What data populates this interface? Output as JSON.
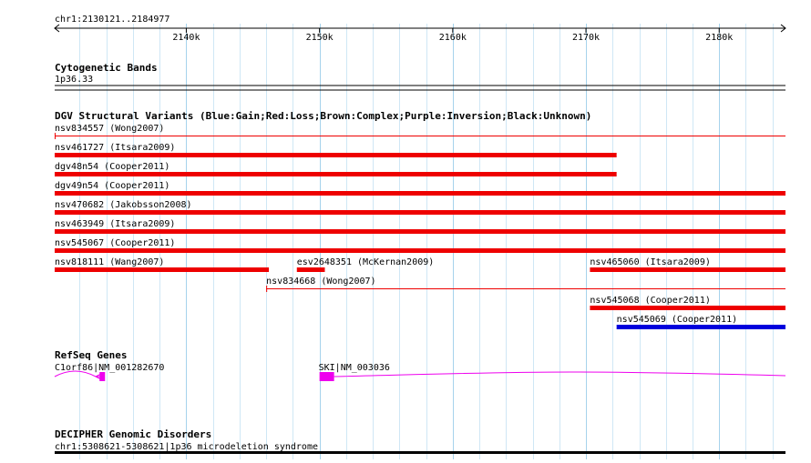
{
  "ruler": {
    "coordinates": "chr1:2130121..2184977",
    "ticks": [
      "2140k",
      "2150k",
      "2160k",
      "2170k",
      "2180k"
    ]
  },
  "tracks": {
    "cytobands": {
      "title": "Cytogenetic Bands",
      "band": "1p36.33"
    },
    "dgv": {
      "title": "DGV Structural Variants (Blue:Gain;Red:Loss;Brown:Complex;Purple:Inversion;Black:Unknown)",
      "colors": {
        "loss": "#ee0000",
        "gain": "#0000dd"
      },
      "variants": [
        {
          "label": "nsv834557 (Wong2007)",
          "start": 2130121,
          "end": 2184977,
          "type": "loss",
          "style": "thin"
        },
        {
          "label": "nsv461727 (Itsara2009)",
          "start": 2130121,
          "end": 2172300,
          "type": "loss",
          "style": "thick"
        },
        {
          "label": "dgv48n54 (Cooper2011)",
          "start": 2130121,
          "end": 2172300,
          "type": "loss",
          "style": "thick"
        },
        {
          "label": "dgv49n54 (Cooper2011)",
          "start": 2130121,
          "end": 2184977,
          "type": "loss",
          "style": "thick"
        },
        {
          "label": "nsv470682 (Jakobsson2008)",
          "start": 2130121,
          "end": 2184977,
          "type": "loss",
          "style": "thick"
        },
        {
          "label": "nsv463949 (Itsara2009)",
          "start": 2130121,
          "end": 2184977,
          "type": "loss",
          "style": "thick"
        },
        {
          "label": "nsv545067 (Cooper2011)",
          "start": 2130121,
          "end": 2184977,
          "type": "loss",
          "style": "thick"
        },
        {
          "label": "nsv818111 (Wang2007)",
          "start": 2130121,
          "end": 2146200,
          "type": "loss",
          "style": "thick"
        },
        {
          "label": "esv2648351 (McKernan2009)",
          "start": 2148300,
          "end": 2150400,
          "type": "loss",
          "style": "thick"
        },
        {
          "label": "nsv465060 (Itsara2009)",
          "start": 2170300,
          "end": 2184977,
          "type": "loss",
          "style": "thick"
        },
        {
          "label": "nsv834668 (Wong2007)",
          "start": 2146000,
          "end": 2184977,
          "type": "loss",
          "style": "thin"
        },
        {
          "label": "nsv545068 (Cooper2011)",
          "start": 2170300,
          "end": 2184977,
          "type": "loss",
          "style": "thick"
        },
        {
          "label": "nsv545069 (Cooper2011)",
          "start": 2172300,
          "end": 2184977,
          "type": "gain",
          "style": "thick"
        }
      ]
    },
    "refseq": {
      "title": "RefSeq Genes",
      "color": "#ee00ee",
      "genes": [
        {
          "label": "C1orf86|NM_001282670",
          "start": 2130121,
          "end": 2133900,
          "strand": "-"
        },
        {
          "label": "SKI|NM_003036",
          "start": 2150000,
          "end": 2184977,
          "strand": "+"
        }
      ]
    },
    "decipher": {
      "title": "DECIPHER Genomic Disorders",
      "label": "chr1:5308621-5308621|1p36 microdeletion syndrome"
    }
  }
}
